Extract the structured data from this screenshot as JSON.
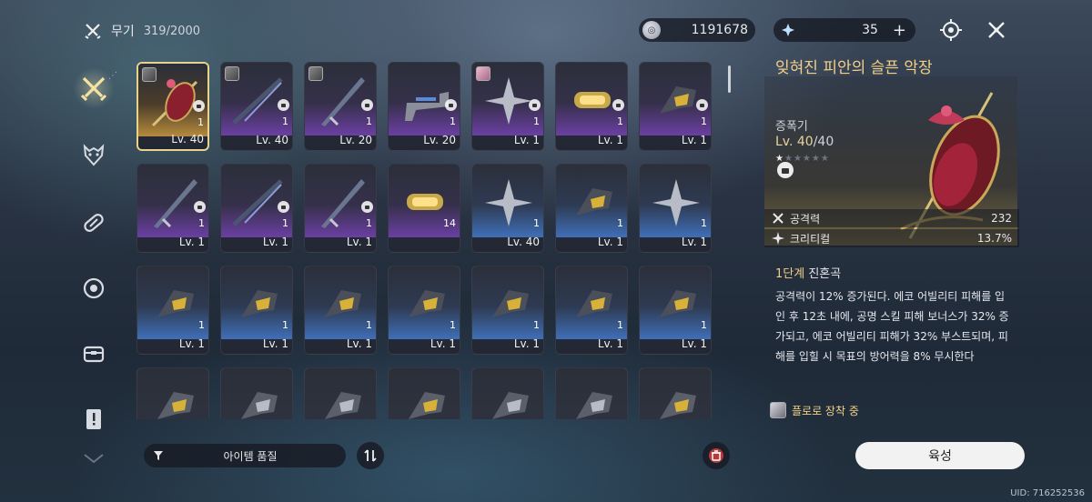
{
  "header": {
    "category_label": "무기",
    "count": "319/2000"
  },
  "currency": {
    "value": "1191678"
  },
  "stamina": {
    "value": "35",
    "plus": "+"
  },
  "sidebar": {
    "items": [
      {
        "name": "weapons",
        "icon": "crossed-swords-icon",
        "active": true
      },
      {
        "name": "echoes",
        "icon": "demon-mask-icon",
        "active": false
      },
      {
        "name": "materials",
        "icon": "capsule-icon",
        "active": false
      },
      {
        "name": "devices",
        "icon": "gear-eye-icon",
        "active": false
      },
      {
        "name": "supplies",
        "icon": "chest-icon",
        "active": false
      },
      {
        "name": "quest-items",
        "icon": "document-exclamation-icon",
        "active": false
      },
      {
        "name": "more",
        "icon": "bird-icon",
        "active": false
      }
    ]
  },
  "inventory": {
    "items": [
      {
        "level": "Lv. 40",
        "qty": "1",
        "rarity": "gold",
        "locked": true,
        "portrait": true,
        "selected": true
      },
      {
        "level": "Lv. 40",
        "qty": "1",
        "rarity": "purple",
        "locked": true,
        "portrait": true
      },
      {
        "level": "Lv. 20",
        "qty": "1",
        "rarity": "purple",
        "locked": true,
        "portrait": true
      },
      {
        "level": "Lv. 20",
        "qty": "1",
        "rarity": "purple",
        "locked": true
      },
      {
        "level": "Lv. 1",
        "qty": "1",
        "rarity": "purple",
        "locked": true,
        "portrait": true,
        "portrait_pink": true
      },
      {
        "level": "Lv. 1",
        "qty": "1",
        "rarity": "purple",
        "locked": true
      },
      {
        "level": "Lv. 1",
        "qty": "1",
        "rarity": "purple",
        "locked": true
      },
      {
        "level": "Lv. 1",
        "qty": "1",
        "rarity": "purple",
        "locked": true
      },
      {
        "level": "Lv. 1",
        "qty": "1",
        "rarity": "purple",
        "locked": true
      },
      {
        "level": "Lv. 1",
        "qty": "1",
        "rarity": "purple",
        "locked": true
      },
      {
        "level": "",
        "qty": "14",
        "rarity": "purple",
        "locked": false
      },
      {
        "level": "Lv. 40",
        "qty": "1",
        "rarity": "blue",
        "locked": false
      },
      {
        "level": "Lv. 1",
        "qty": "1",
        "rarity": "blue",
        "locked": false
      },
      {
        "level": "Lv. 1",
        "qty": "1",
        "rarity": "blue",
        "locked": false
      },
      {
        "level": "Lv. 1",
        "qty": "1",
        "rarity": "blue",
        "locked": false
      },
      {
        "level": "Lv. 1",
        "qty": "1",
        "rarity": "blue",
        "locked": false
      },
      {
        "level": "Lv. 1",
        "qty": "1",
        "rarity": "blue",
        "locked": false
      },
      {
        "level": "Lv. 1",
        "qty": "1",
        "rarity": "blue",
        "locked": false
      },
      {
        "level": "Lv. 1",
        "qty": "1",
        "rarity": "blue",
        "locked": false
      },
      {
        "level": "Lv. 1",
        "qty": "1",
        "rarity": "blue",
        "locked": false
      },
      {
        "level": "Lv. 1",
        "qty": "1",
        "rarity": "blue",
        "locked": false
      },
      {
        "level": "",
        "qty": "",
        "rarity": "gray",
        "locked": false
      },
      {
        "level": "",
        "qty": "",
        "rarity": "gray",
        "locked": false
      },
      {
        "level": "",
        "qty": "",
        "rarity": "gray",
        "locked": false
      },
      {
        "level": "",
        "qty": "",
        "rarity": "gray",
        "locked": false
      },
      {
        "level": "",
        "qty": "",
        "rarity": "gray",
        "locked": false
      },
      {
        "level": "",
        "qty": "",
        "rarity": "gray",
        "locked": false
      },
      {
        "level": "",
        "qty": "",
        "rarity": "gray",
        "locked": false
      }
    ]
  },
  "filter": {
    "label": "아이템 품질"
  },
  "detail": {
    "title": "잊혀진 피안의 슬픈 악장",
    "type": "증폭기",
    "level": "Lv. 40",
    "level_max": "/40",
    "stars_total": 6,
    "stars_on": 1,
    "stats": [
      {
        "name": "공격력",
        "value": "232",
        "icon": "crossed-swords-icon"
      },
      {
        "name": "크리티컬",
        "value": "13.7%",
        "icon": "starburst-icon"
      }
    ],
    "passive_rank": "1단계",
    "passive_name": "진혼곡",
    "passive_desc": "공격력이 12% 증가된다. 에코 어빌리티 피해를 입인 후 12초 내에, 공명 스킬 피해 보너스가 32% 증가되고, 에코 어빌리티 피해가 32% 부스트되며, 피해를 입힐 시 목표의 방어력을 8% 무시한다",
    "equipped_by": "플로로 장착 중",
    "upgrade_label": "육성"
  },
  "uid": "UID: 716252536"
}
